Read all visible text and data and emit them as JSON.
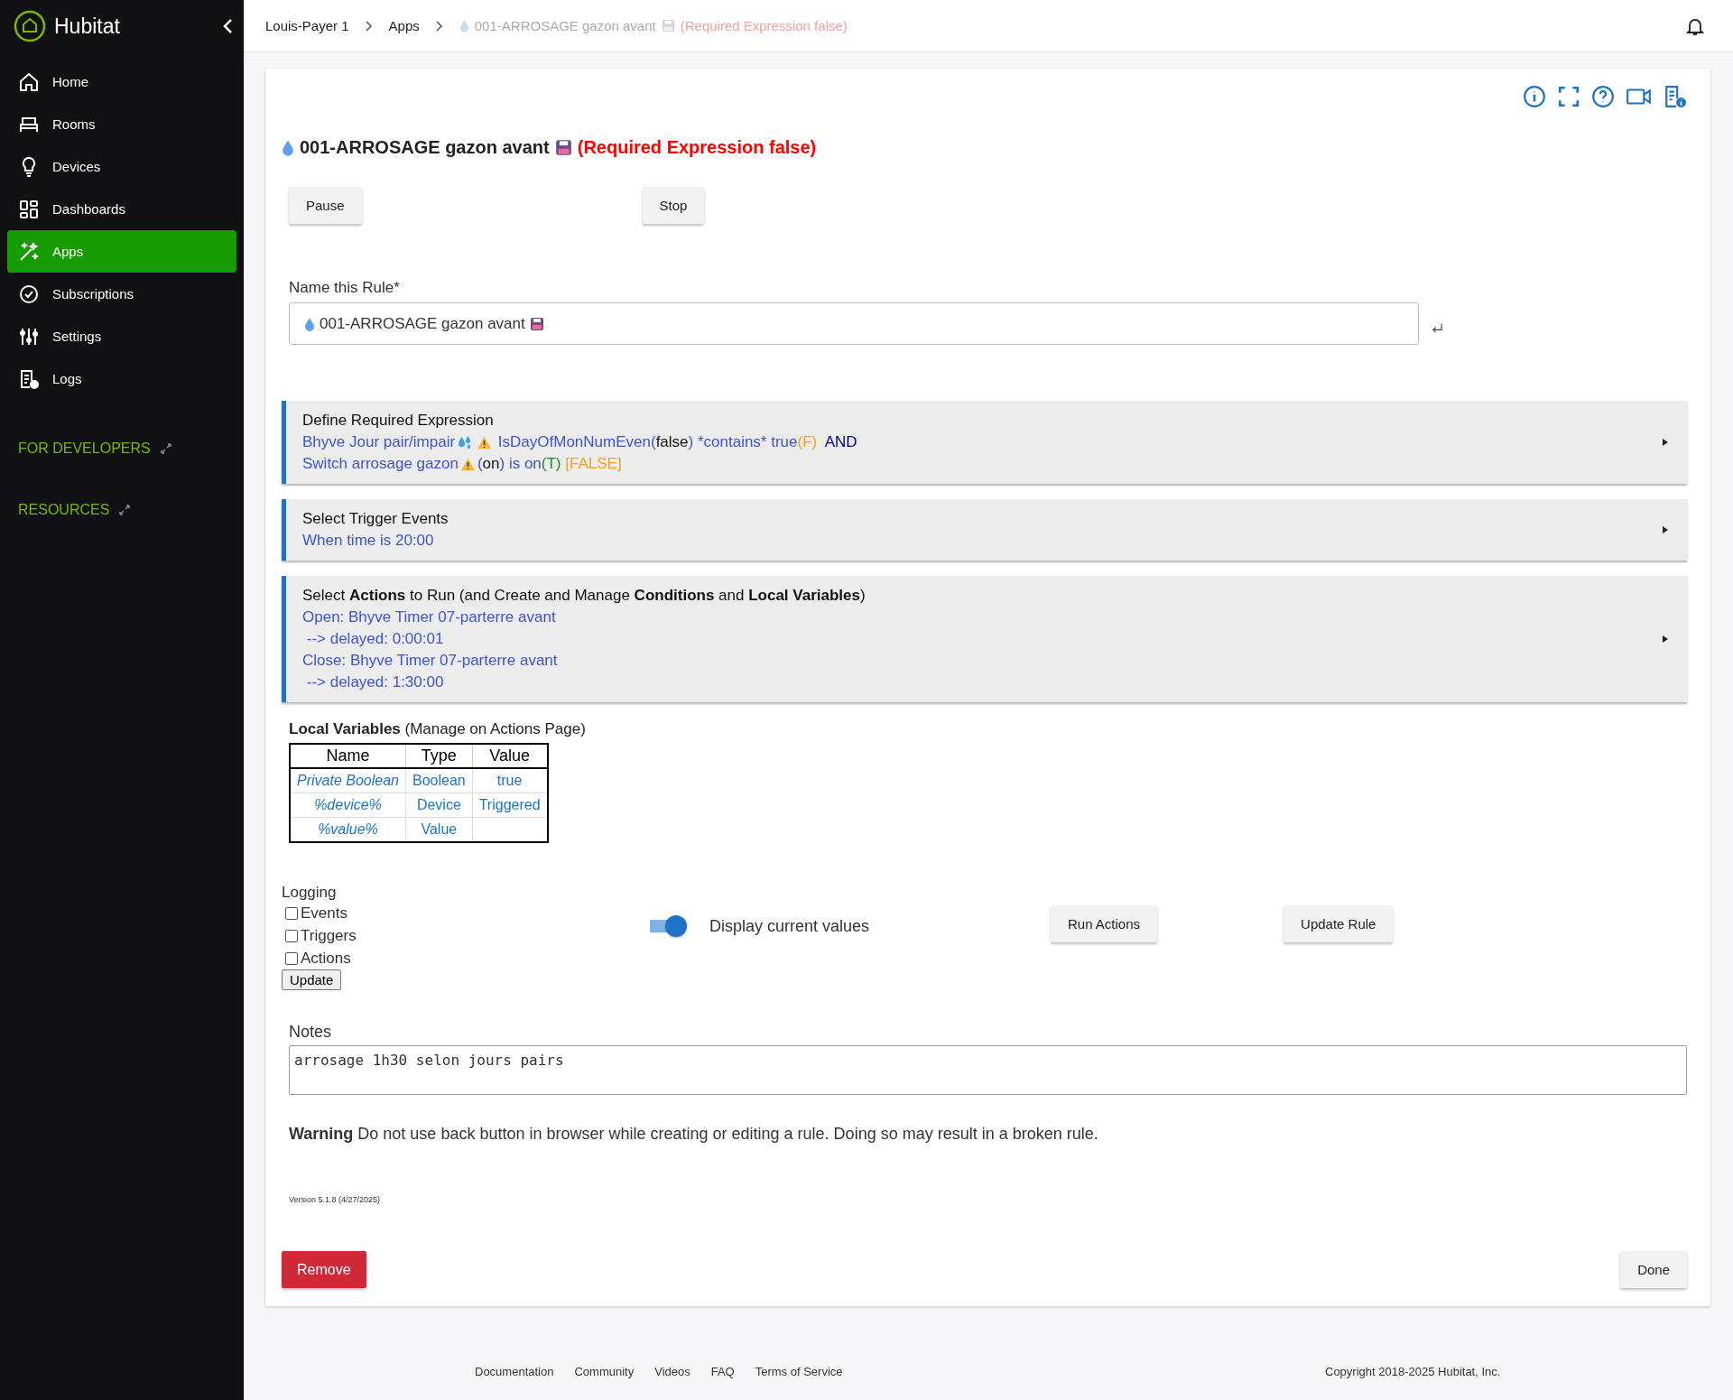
{
  "sidebar": {
    "brand": "Hubitat",
    "items": [
      {
        "label": "Home",
        "kind": "home",
        "selected": false
      },
      {
        "label": "Rooms",
        "kind": "rooms",
        "selected": false
      },
      {
        "label": "Devices",
        "kind": "devices",
        "selected": false
      },
      {
        "label": "Dashboards",
        "kind": "dashboards",
        "selected": false
      },
      {
        "label": "Apps",
        "kind": "apps",
        "selected": true
      },
      {
        "label": "Subscriptions",
        "kind": "subscriptions",
        "selected": false
      },
      {
        "label": "Settings",
        "kind": "settings",
        "selected": false
      },
      {
        "label": "Logs",
        "kind": "logs",
        "selected": false
      }
    ],
    "links": [
      "FOR DEVELOPERS",
      "RESOURCES"
    ]
  },
  "breadcrumb": {
    "items": [
      "Louis-Payer 1",
      "Apps"
    ],
    "current": "001-ARROSAGE gazon avant",
    "status": "(Required Expression false)"
  },
  "title": {
    "name": "001-ARROSAGE gazon avant",
    "status": "(Required Expression false)"
  },
  "top_buttons": [
    "Pause",
    "Stop"
  ],
  "name_field": {
    "label": "Name this Rule*",
    "value": "001-ARROSAGE gazon avant"
  },
  "sections": [
    {
      "title": "Define Required Expression",
      "lines": [
        [
          {
            "kind": "text",
            "text": "Bhyve Jour pair/impair",
            "color": "#3d55c6"
          },
          {
            "kind": "splash"
          },
          {
            "kind": "warning"
          },
          {
            "kind": "text",
            "text": " IsDayOfMonNumEven(",
            "color": "#3d55c6"
          },
          {
            "kind": "text",
            "text": "false",
            "color": "#111111"
          },
          {
            "kind": "text",
            "text": ") *contains* true",
            "color": "#3d55c6"
          },
          {
            "kind": "text",
            "text": "(F)",
            "color": "#f5a11c"
          },
          {
            "kind": "text",
            "text": "  AND",
            "color": "#00007f"
          }
        ],
        [
          {
            "kind": "text",
            "text": "Switch arrosage gazon",
            "color": "#3d55c6"
          },
          {
            "kind": "warning"
          },
          {
            "kind": "text",
            "text": "(",
            "color": "#3d55c6"
          },
          {
            "kind": "text",
            "text": "on",
            "color": "#111111"
          },
          {
            "kind": "text",
            "text": ") is on",
            "color": "#3d55c6"
          },
          {
            "kind": "text",
            "text": "(T)",
            "color": "#1b8a2a"
          },
          {
            "kind": "text",
            "text": " [FALSE]",
            "color": "#f5a11c"
          }
        ]
      ]
    },
    {
      "title": "Select Trigger Events",
      "lines": [
        [
          {
            "kind": "text",
            "text": "When time is 20:00",
            "color": "#3d55c6"
          }
        ]
      ]
    },
    {
      "title": "Select **Actions** to Run (and Create and Manage **Conditions** and **Local Variables**)",
      "lines": [
        [
          {
            "kind": "text",
            "text": "Open: Bhyve Timer 07-parterre avant",
            "color": "#3d55c6"
          }
        ],
        [
          {
            "kind": "text",
            "text": " --> delayed: 0:00:01",
            "color": "#3d55c6"
          }
        ],
        [
          {
            "kind": "text",
            "text": "Close: Bhyve Timer 07-parterre avant",
            "color": "#3d55c6"
          }
        ],
        [
          {
            "kind": "text",
            "text": " --> delayed: 1:30:00",
            "color": "#3d55c6"
          }
        ]
      ]
    }
  ],
  "local_variables": {
    "heading": "**Local Variables** (Manage on Actions Page)",
    "columns": [
      "Name",
      "Type",
      "Value"
    ],
    "rows": [
      [
        "Private Boolean",
        "Boolean",
        "true"
      ],
      [
        "%device%",
        "Device",
        "Triggered"
      ],
      [
        "%value%",
        "Value",
        ""
      ]
    ]
  },
  "logging": {
    "label": "Logging",
    "options": [
      {
        "label": "Events",
        "checked": false
      },
      {
        "label": "Triggers",
        "checked": false
      },
      {
        "label": "Actions",
        "checked": false
      }
    ],
    "button": "Update"
  },
  "display_values": {
    "label": "Display current values",
    "on": true
  },
  "action_buttons": [
    "Run Actions",
    "Update Rule"
  ],
  "notes": {
    "label": "Notes",
    "value": "arrosage 1h30 selon jours pairs"
  },
  "warning": "**Warning** Do not use back button in browser while creating or editing a rule. Doing so may result in a broken rule.",
  "version": "Version 5.1.8 (4/27/2025)",
  "bottom_buttons": {
    "remove": "Remove",
    "done": "Done"
  },
  "footer": {
    "links": [
      "Documentation",
      "Community",
      "Videos",
      "FAQ",
      "Terms of Service"
    ],
    "copyright": "Copyright 2018-2025 Hubitat, Inc."
  }
}
